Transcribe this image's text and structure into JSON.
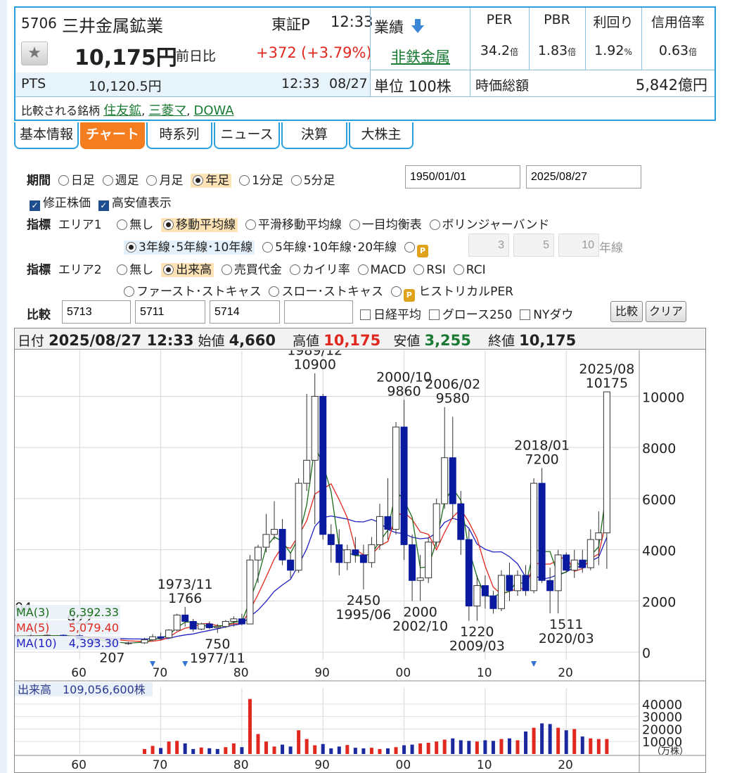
{
  "stock": {
    "code": "5706",
    "name": "三井金属鉱業",
    "market": "東証P",
    "time": "12:33",
    "price": "10,175円",
    "compare_label": "前日比",
    "change": "+372",
    "change_pct": "(+3.79%)",
    "pts_label": "PTS",
    "pts_price": "10,120.5円",
    "pts_time": "12:33",
    "pts_date": "08/27",
    "peers_label": "比較される銘柄",
    "peers": [
      "住友鉱",
      "三菱マ",
      "DOWA"
    ],
    "results_label": "業績",
    "sector": "非鉄金属",
    "unit": "単位 100株",
    "metrics": [
      {
        "label": "PER",
        "value": "34.2",
        "suffix": "倍"
      },
      {
        "label": "PBR",
        "value": "1.83",
        "suffix": "倍"
      },
      {
        "label": "利回り",
        "value": "1.92",
        "suffix": "%"
      },
      {
        "label": "信用倍率",
        "value": "0.63",
        "suffix": "倍"
      }
    ],
    "mcap_label": "時価総額",
    "mcap_value": "5,842億円"
  },
  "tabs": [
    "基本情報",
    "チャート",
    "時系列",
    "ニュース",
    "決算",
    "大株主"
  ],
  "controls": {
    "period_label": "期間",
    "periods": [
      "日足",
      "週足",
      "月足",
      "年足",
      "1分足",
      "5分足"
    ],
    "date_from": "1950/01/01",
    "date_to": "2025/08/27",
    "adjusted": "修正株価",
    "highlow": "高安値表示",
    "ind_label": "指標",
    "area1": "エリア1",
    "area2": "エリア2",
    "area1_opts": [
      "無し",
      "移動平均線",
      "平滑移動平均線",
      "一目均衡表",
      "ボリンジャーバンド"
    ],
    "ma_opts": [
      "3年線･5年線･10年線",
      "5年線･10年線･20年線"
    ],
    "ma_custom": [
      "3",
      "5",
      "10"
    ],
    "ma_custom_unit": "年線",
    "area2_opts": [
      "無し",
      "出来高",
      "売買代金",
      "カイリ率",
      "MACD",
      "RSI",
      "RCI"
    ],
    "area2_opts2": [
      "ファースト･ストキャス",
      "スロー･ストキャス",
      "ヒストリカルPER"
    ],
    "compare_label": "比較",
    "compare_codes": [
      "5713",
      "5711",
      "5714",
      ""
    ],
    "compare_idx": [
      "日経平均",
      "グロース250",
      "NYダウ"
    ],
    "btn_compare": "比較",
    "btn_clear": "クリア",
    "lock_icon": "lock-p-icon"
  },
  "ohlc_header": {
    "date_label": "日付",
    "date": "2025/08/27 12:33",
    "open_label": "始値",
    "open": "4,660",
    "high_label": "高値",
    "high": "10,175",
    "low_label": "安値",
    "low": "3,255",
    "close_label": "終値",
    "close": "10,175"
  },
  "ma_legend": [
    {
      "label": "MA(3)",
      "value": "6,392.33",
      "color": "#1a6e1a"
    },
    {
      "label": "MA(5)",
      "value": "5,079.40",
      "color": "#e0281e"
    },
    {
      "label": "MA(10)",
      "value": "4,393.30",
      "color": "#2020c0"
    }
  ],
  "volume_legend": "出来高　109,056,600株",
  "chart_data": {
    "type": "candlestick",
    "x_ticks": [
      "60",
      "70",
      "80",
      "90",
      "00",
      "10",
      "20"
    ],
    "y_ticks": [
      "0",
      "2000",
      "4000",
      "6000",
      "8000",
      "10000"
    ],
    "ylim": [
      -300,
      11800
    ],
    "xlim": [
      1952,
      2029
    ],
    "colors": {
      "up": "#ffffff",
      "down": "#0a1a9e",
      "wick": "#333333",
      "grid": "#cccccc"
    },
    "candles": [
      {
        "year": 1952,
        "open": 580,
        "high": 1404,
        "low": 560,
        "close": 620
      },
      {
        "year": 1954,
        "open": 620,
        "high": 1200,
        "low": 590,
        "close": 640
      },
      {
        "year": 1956,
        "open": 640,
        "high": 1220,
        "low": 600,
        "close": 660
      },
      {
        "year": 1958,
        "open": 660,
        "high": 700,
        "low": 580,
        "close": 640
      },
      {
        "year": 1960,
        "open": 640,
        "high": 922,
        "low": 420,
        "close": 520
      },
      {
        "year": 1962,
        "open": 520,
        "high": 560,
        "low": 300,
        "close": 360
      },
      {
        "year": 1964,
        "open": 360,
        "high": 400,
        "low": 207,
        "close": 330
      },
      {
        "year": 1966,
        "open": 330,
        "high": 400,
        "low": 280,
        "close": 360
      },
      {
        "year": 1968,
        "open": 360,
        "high": 560,
        "low": 320,
        "close": 480
      },
      {
        "year": 1969,
        "open": 480,
        "high": 700,
        "low": 420,
        "close": 600
      },
      {
        "year": 1970,
        "open": 600,
        "high": 760,
        "low": 480,
        "close": 560
      },
      {
        "year": 1971,
        "open": 560,
        "high": 900,
        "low": 520,
        "close": 860
      },
      {
        "year": 1972,
        "open": 860,
        "high": 1500,
        "low": 820,
        "close": 1450
      },
      {
        "year": 1973,
        "open": 1450,
        "high": 1766,
        "low": 1000,
        "close": 1200
      },
      {
        "year": 1974,
        "open": 1200,
        "high": 1300,
        "low": 800,
        "close": 900
      },
      {
        "year": 1975,
        "open": 900,
        "high": 1150,
        "low": 850,
        "close": 1100
      },
      {
        "year": 1976,
        "open": 1100,
        "high": 1200,
        "low": 900,
        "close": 950
      },
      {
        "year": 1977,
        "open": 950,
        "high": 1100,
        "low": 750,
        "close": 1000
      },
      {
        "year": 1978,
        "open": 1000,
        "high": 1250,
        "low": 950,
        "close": 1200
      },
      {
        "year": 1979,
        "open": 1200,
        "high": 1400,
        "low": 1000,
        "close": 1300
      },
      {
        "year": 1980,
        "open": 1300,
        "high": 1500,
        "low": 1050,
        "close": 1100
      },
      {
        "year": 1981,
        "open": 1100,
        "high": 3800,
        "low": 1100,
        "close": 3600
      },
      {
        "year": 1982,
        "open": 3600,
        "high": 4200,
        "low": 2700,
        "close": 4100
      },
      {
        "year": 1983,
        "open": 4100,
        "high": 5400,
        "low": 3900,
        "close": 4600
      },
      {
        "year": 1984,
        "open": 4600,
        "high": 5900,
        "low": 4400,
        "close": 4800
      },
      {
        "year": 1985,
        "open": 4800,
        "high": 5200,
        "low": 3400,
        "close": 3600
      },
      {
        "year": 1986,
        "open": 3600,
        "high": 3900,
        "low": 2900,
        "close": 3200
      },
      {
        "year": 1987,
        "open": 3200,
        "high": 6800,
        "low": 3100,
        "close": 6600
      },
      {
        "year": 1988,
        "open": 6600,
        "high": 10100,
        "low": 6300,
        "close": 7500
      },
      {
        "year": 1989,
        "open": 7500,
        "high": 10900,
        "low": 5000,
        "close": 10000
      },
      {
        "year": 1990,
        "open": 10000,
        "high": 10100,
        "low": 4400,
        "close": 4600
      },
      {
        "year": 1991,
        "open": 4600,
        "high": 5000,
        "low": 3500,
        "close": 4200
      },
      {
        "year": 1992,
        "open": 4200,
        "high": 4800,
        "low": 3000,
        "close": 3500
      },
      {
        "year": 1993,
        "open": 3500,
        "high": 4200,
        "low": 3200,
        "close": 4000
      },
      {
        "year": 1994,
        "open": 4000,
        "high": 4500,
        "low": 3500,
        "close": 3800
      },
      {
        "year": 1995,
        "open": 3800,
        "high": 4200,
        "low": 2450,
        "close": 3500
      },
      {
        "year": 1996,
        "open": 3500,
        "high": 4500,
        "low": 3300,
        "close": 4200
      },
      {
        "year": 1997,
        "open": 4200,
        "high": 5800,
        "low": 4000,
        "close": 5300
      },
      {
        "year": 1998,
        "open": 5300,
        "high": 6800,
        "low": 4400,
        "close": 4800
      },
      {
        "year": 1999,
        "open": 4800,
        "high": 9000,
        "low": 4600,
        "close": 8800
      },
      {
        "year": 2000,
        "open": 8800,
        "high": 9860,
        "low": 3600,
        "close": 4200
      },
      {
        "year": 2001,
        "open": 4200,
        "high": 4600,
        "low": 2000,
        "close": 2800
      },
      {
        "year": 2002,
        "open": 2800,
        "high": 3800,
        "low": 2000,
        "close": 2900
      },
      {
        "year": 2003,
        "open": 2900,
        "high": 4500,
        "low": 2700,
        "close": 4300
      },
      {
        "year": 2004,
        "open": 4300,
        "high": 6000,
        "low": 4100,
        "close": 5800
      },
      {
        "year": 2005,
        "open": 5800,
        "high": 9580,
        "low": 5600,
        "close": 7600
      },
      {
        "year": 2006,
        "open": 7600,
        "high": 9200,
        "low": 5200,
        "close": 5800
      },
      {
        "year": 2007,
        "open": 5800,
        "high": 6300,
        "low": 3800,
        "close": 4400
      },
      {
        "year": 2008,
        "open": 4400,
        "high": 4800,
        "low": 1220,
        "close": 1800
      },
      {
        "year": 2009,
        "open": 1800,
        "high": 3000,
        "low": 1220,
        "close": 2600
      },
      {
        "year": 2010,
        "open": 2600,
        "high": 3000,
        "low": 1700,
        "close": 2200
      },
      {
        "year": 2011,
        "open": 2200,
        "high": 2400,
        "low": 1500,
        "close": 1700
      },
      {
        "year": 2012,
        "open": 1700,
        "high": 3200,
        "low": 1600,
        "close": 3000
      },
      {
        "year": 2013,
        "open": 3000,
        "high": 3500,
        "low": 2000,
        "close": 2400
      },
      {
        "year": 2014,
        "open": 2400,
        "high": 3200,
        "low": 2200,
        "close": 3000
      },
      {
        "year": 2015,
        "open": 3000,
        "high": 3400,
        "low": 2200,
        "close": 2400
      },
      {
        "year": 2016,
        "open": 2400,
        "high": 6800,
        "low": 2300,
        "close": 6600
      },
      {
        "year": 2017,
        "open": 6600,
        "high": 7200,
        "low": 2700,
        "close": 2800
      },
      {
        "year": 2018,
        "open": 2800,
        "high": 3300,
        "low": 1511,
        "close": 2400
      },
      {
        "year": 2019,
        "open": 2400,
        "high": 4000,
        "low": 1511,
        "close": 3800
      },
      {
        "year": 2020,
        "open": 3800,
        "high": 3900,
        "low": 3100,
        "close": 3200
      },
      {
        "year": 2021,
        "open": 3200,
        "high": 4000,
        "low": 2900,
        "close": 3600
      },
      {
        "year": 2022,
        "open": 3600,
        "high": 4000,
        "low": 3100,
        "close": 3300
      },
      {
        "year": 2023,
        "open": 3300,
        "high": 4800,
        "low": 3200,
        "close": 4400
      },
      {
        "year": 2024,
        "open": 4400,
        "high": 5500,
        "low": 3400,
        "close": 4660
      },
      {
        "year": 2025,
        "open": 4660,
        "high": 10175,
        "low": 3255,
        "close": 10175
      }
    ],
    "annotations": [
      {
        "year": 1952,
        "price": 1404,
        "pos": "top",
        "lines": [
          "1404"
        ]
      },
      {
        "year": 1960,
        "price": 922,
        "pos": "top",
        "lines": [
          "922"
        ]
      },
      {
        "year": 1964,
        "price": 207,
        "pos": "bottom",
        "lines": [
          "207"
        ]
      },
      {
        "year": 1973,
        "price": 1766,
        "pos": "top",
        "lines": [
          "1973/11",
          "1766"
        ]
      },
      {
        "year": 1977,
        "price": 750,
        "pos": "bottom",
        "lines": [
          "750",
          "1977/11"
        ]
      },
      {
        "year": 1989,
        "price": 10900,
        "pos": "top",
        "lines": [
          "1989/12",
          "10900"
        ]
      },
      {
        "year": 1995,
        "price": 2450,
        "pos": "bottom",
        "lines": [
          "2450",
          "1995/06"
        ]
      },
      {
        "year": 2000,
        "price": 9860,
        "pos": "top",
        "lines": [
          "2000/10",
          "9860"
        ]
      },
      {
        "year": 2002,
        "price": 2000,
        "pos": "bottom",
        "lines": [
          "2000",
          "2002/10"
        ]
      },
      {
        "year": 2006,
        "price": 9580,
        "pos": "top",
        "lines": [
          "2006/02",
          "9580"
        ]
      },
      {
        "year": 2009,
        "price": 1220,
        "pos": "bottom",
        "lines": [
          "1220",
          "2009/03"
        ]
      },
      {
        "year": 2017,
        "price": 7200,
        "pos": "top",
        "lines": [
          "2018/01",
          "7200"
        ]
      },
      {
        "year": 2020,
        "price": 1511,
        "pos": "bottom",
        "lines": [
          "1511",
          "2020/03"
        ]
      },
      {
        "year": 2025,
        "price": 10175,
        "pos": "top",
        "lines": [
          "2025/08",
          "10175"
        ]
      }
    ],
    "markers": [
      1969,
      1973,
      2016
    ],
    "volume": {
      "y_ticks": [
        "10000",
        "20000",
        "30000",
        "40000"
      ],
      "unit": "（万株）",
      "ylim": [
        0,
        45000
      ],
      "bars": [
        {
          "year": 1968,
          "value": 4000,
          "dir": "up"
        },
        {
          "year": 1969,
          "value": 6500,
          "dir": "up"
        },
        {
          "year": 1970,
          "value": 4800,
          "dir": "down"
        },
        {
          "year": 1971,
          "value": 10000,
          "dir": "up"
        },
        {
          "year": 1972,
          "value": 10500,
          "dir": "up"
        },
        {
          "year": 1973,
          "value": 8500,
          "dir": "down"
        },
        {
          "year": 1974,
          "value": 4000,
          "dir": "down"
        },
        {
          "year": 1975,
          "value": 5200,
          "dir": "up"
        },
        {
          "year": 1976,
          "value": 4600,
          "dir": "down"
        },
        {
          "year": 1977,
          "value": 4000,
          "dir": "down"
        },
        {
          "year": 1978,
          "value": 5500,
          "dir": "up"
        },
        {
          "year": 1979,
          "value": 8500,
          "dir": "up"
        },
        {
          "year": 1980,
          "value": 5500,
          "dir": "down"
        },
        {
          "year": 1981,
          "value": 44000,
          "dir": "up"
        },
        {
          "year": 1982,
          "value": 16000,
          "dir": "up"
        },
        {
          "year": 1983,
          "value": 10000,
          "dir": "up"
        },
        {
          "year": 1984,
          "value": 6000,
          "dir": "up"
        },
        {
          "year": 1985,
          "value": 7500,
          "dir": "down"
        },
        {
          "year": 1986,
          "value": 6000,
          "dir": "down"
        },
        {
          "year": 1987,
          "value": 19000,
          "dir": "up"
        },
        {
          "year": 1988,
          "value": 12000,
          "dir": "up"
        },
        {
          "year": 1989,
          "value": 7000,
          "dir": "up"
        },
        {
          "year": 1990,
          "value": 8000,
          "dir": "down"
        },
        {
          "year": 1991,
          "value": 4500,
          "dir": "down"
        },
        {
          "year": 1992,
          "value": 6000,
          "dir": "down"
        },
        {
          "year": 1993,
          "value": 7200,
          "dir": "up"
        },
        {
          "year": 1994,
          "value": 5000,
          "dir": "down"
        },
        {
          "year": 1995,
          "value": 4500,
          "dir": "down"
        },
        {
          "year": 1996,
          "value": 5000,
          "dir": "up"
        },
        {
          "year": 1997,
          "value": 4000,
          "dir": "up"
        },
        {
          "year": 1998,
          "value": 4500,
          "dir": "down"
        },
        {
          "year": 1999,
          "value": 5500,
          "dir": "up"
        },
        {
          "year": 2000,
          "value": 7000,
          "dir": "down"
        },
        {
          "year": 2001,
          "value": 7500,
          "dir": "down"
        },
        {
          "year": 2002,
          "value": 8500,
          "dir": "up"
        },
        {
          "year": 2003,
          "value": 9000,
          "dir": "up"
        },
        {
          "year": 2004,
          "value": 10000,
          "dir": "up"
        },
        {
          "year": 2005,
          "value": 11500,
          "dir": "up"
        },
        {
          "year": 2006,
          "value": 12500,
          "dir": "down"
        },
        {
          "year": 2007,
          "value": 11000,
          "dir": "down"
        },
        {
          "year": 2008,
          "value": 10500,
          "dir": "down"
        },
        {
          "year": 2009,
          "value": 10000,
          "dir": "up"
        },
        {
          "year": 2010,
          "value": 11000,
          "dir": "down"
        },
        {
          "year": 2011,
          "value": 10500,
          "dir": "down"
        },
        {
          "year": 2012,
          "value": 12000,
          "dir": "up"
        },
        {
          "year": 2013,
          "value": 12500,
          "dir": "down"
        },
        {
          "year": 2014,
          "value": 11000,
          "dir": "up"
        },
        {
          "year": 2015,
          "value": 18000,
          "dir": "down"
        },
        {
          "year": 2016,
          "value": 21000,
          "dir": "up"
        },
        {
          "year": 2017,
          "value": 24500,
          "dir": "down"
        },
        {
          "year": 2018,
          "value": 24000,
          "dir": "down"
        },
        {
          "year": 2019,
          "value": 21000,
          "dir": "up"
        },
        {
          "year": 2020,
          "value": 19000,
          "dir": "down"
        },
        {
          "year": 2021,
          "value": 20000,
          "dir": "up"
        },
        {
          "year": 2022,
          "value": 14000,
          "dir": "down"
        },
        {
          "year": 2023,
          "value": 12500,
          "dir": "up"
        },
        {
          "year": 2024,
          "value": 12000,
          "dir": "up"
        },
        {
          "year": 2025,
          "value": 12000,
          "dir": "up"
        }
      ]
    }
  }
}
